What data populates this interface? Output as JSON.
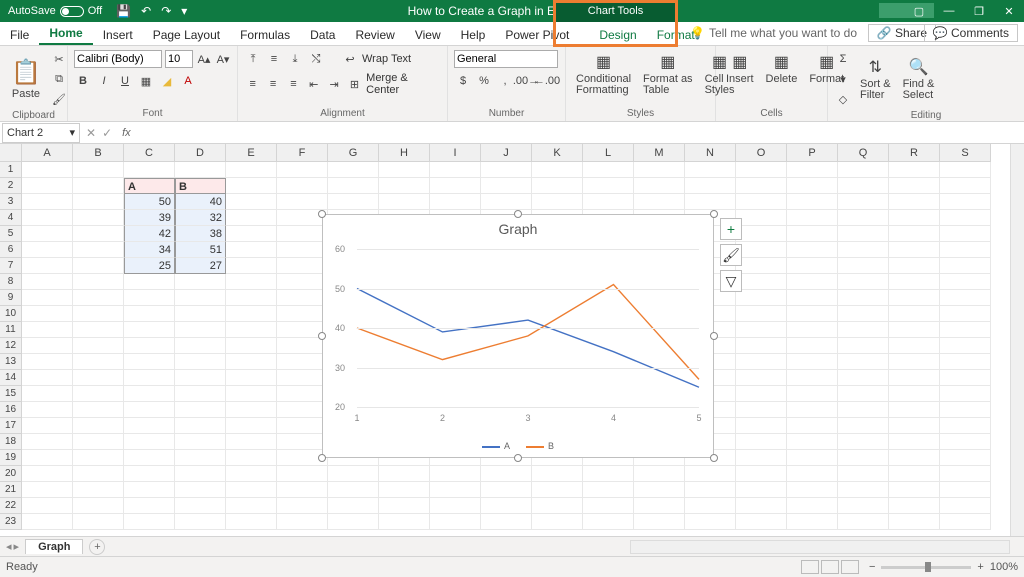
{
  "titlebar": {
    "autosave": "AutoSave",
    "autosave_state": "Off",
    "doc_title": "How to Create a Graph in Excel  -  Excel",
    "chart_tools": "Chart Tools"
  },
  "tabs": {
    "file": "File",
    "home": "Home",
    "insert": "Insert",
    "page_layout": "Page Layout",
    "formulas": "Formulas",
    "data": "Data",
    "review": "Review",
    "view": "View",
    "help": "Help",
    "power_pivot": "Power Pivot",
    "design": "Design",
    "format": "Format",
    "tell_me": "Tell me what you want to do",
    "share": "Share",
    "comments": "Comments"
  },
  "ribbon": {
    "clipboard": {
      "paste": "Paste",
      "label": "Clipboard"
    },
    "font": {
      "name": "Calibri (Body)",
      "size": "10",
      "label": "Font"
    },
    "alignment": {
      "wrap": "Wrap Text",
      "merge": "Merge & Center",
      "label": "Alignment"
    },
    "number": {
      "format": "General",
      "label": "Number"
    },
    "styles": {
      "cond": "Conditional\nFormatting",
      "table": "Format as\nTable",
      "cell": "Cell\nStyles",
      "label": "Styles"
    },
    "cells": {
      "insert": "Insert",
      "delete": "Delete",
      "format": "Format",
      "label": "Cells"
    },
    "editing": {
      "sort": "Sort &\nFilter",
      "find": "Find &\nSelect",
      "label": "Editing"
    }
  },
  "namebox": "Chart 2",
  "sheet": {
    "col_headers": [
      "A",
      "B",
      "C",
      "D",
      "E",
      "F",
      "G",
      "H",
      "I",
      "J",
      "K",
      "L",
      "M",
      "N",
      "O",
      "P",
      "Q",
      "R",
      "S"
    ],
    "row_headers": [
      "1",
      "2",
      "3",
      "4",
      "5",
      "6",
      "7",
      "8",
      "9",
      "10",
      "11",
      "12",
      "13",
      "14",
      "15",
      "16",
      "17",
      "18",
      "19",
      "20",
      "21",
      "22",
      "23"
    ],
    "table_headers": [
      "A",
      "B"
    ],
    "table_rows": [
      [
        "50",
        "40"
      ],
      [
        "39",
        "32"
      ],
      [
        "42",
        "38"
      ],
      [
        "34",
        "51"
      ],
      [
        "25",
        "27"
      ]
    ]
  },
  "chart_data": {
    "type": "line",
    "title": "Graph",
    "categories": [
      "1",
      "2",
      "3",
      "4",
      "5"
    ],
    "series": [
      {
        "name": "A",
        "color": "#4472c4",
        "values": [
          50,
          39,
          42,
          34,
          25
        ]
      },
      {
        "name": "B",
        "color": "#ed7d31",
        "values": [
          40,
          32,
          38,
          51,
          27
        ]
      }
    ],
    "ylim": [
      20,
      60
    ],
    "yticks": [
      20,
      30,
      40,
      50,
      60
    ],
    "xlabel": "",
    "ylabel": ""
  },
  "sheettabs": {
    "active": "Graph"
  },
  "status": {
    "ready": "Ready",
    "zoom": "100%"
  }
}
